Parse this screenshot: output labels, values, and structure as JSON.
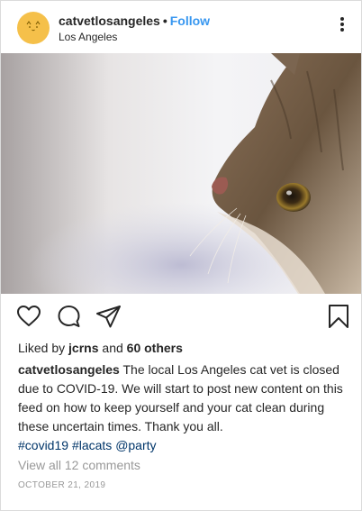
{
  "header": {
    "username": "catvetlosangeles",
    "separator": "•",
    "follow_label": "Follow",
    "location": "Los Angeles"
  },
  "photo": {
    "subject": "cat-photo"
  },
  "actions": {
    "icons": [
      "heart-icon",
      "comment-icon",
      "share-icon",
      "bookmark-icon"
    ]
  },
  "likes": {
    "prefix": "Liked by",
    "user": "jcrns",
    "joiner": "and",
    "others": "60 others"
  },
  "caption": {
    "username": "catvetlosangeles",
    "text": "The local Los Angeles cat vet is closed due to COVID-19. We will start to post new content on this feed on how to keep yourself and your cat clean during these uncertain times. Thank you all."
  },
  "tags": [
    "#covid19",
    "#lacats",
    "@party"
  ],
  "comments_link": "View all 12 comments",
  "date": "OCTOBER 21, 2019",
  "colors": {
    "follow": "#3897f0",
    "hashtag": "#003569",
    "muted": "#999999",
    "text": "#262626",
    "avatar": "#f5c04a"
  }
}
